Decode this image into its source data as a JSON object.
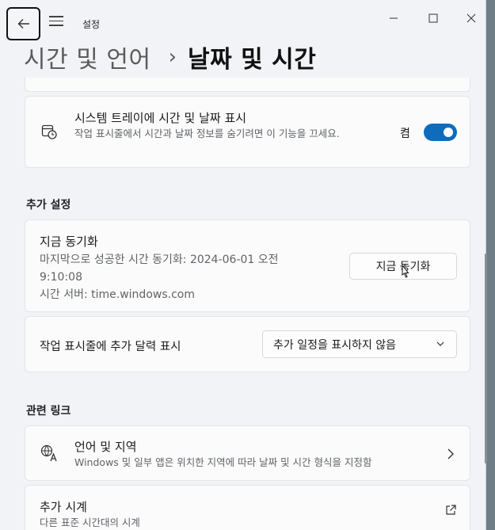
{
  "app": {
    "title": "설정"
  },
  "header": {
    "parent": "시간 및 언어",
    "separator": "›",
    "current": "날짜 및 시간"
  },
  "tray_card": {
    "title": "시스템 트레이에 시간 및 날짜 표시",
    "description": "작업 표시줄에서 시간과 날짜 정보를 숨기려면 이 기능을 끄세요.",
    "toggle_label": "켬",
    "toggle_on": true
  },
  "additional_settings": {
    "heading": "추가 설정",
    "sync": {
      "title": "지금 동기화",
      "last_sync_line1": "마지막으로 성공한 시간 동기화: 2024-06-01 오전",
      "last_sync_line2": "9:10:08",
      "server": "시간 서버: time.windows.com",
      "button_label": "지금 동기화"
    },
    "calendar": {
      "label": "작업 표시줄에 추가 달력 표시",
      "selected": "추가 일정을 표시하지 않음"
    }
  },
  "related_links": {
    "heading": "관련 링크",
    "language_region": {
      "title": "언어 및 지역",
      "description": "Windows 및 일부 앱은 위치한 지역에 따라 날짜 및 시간 형식을 지정함"
    },
    "additional_clocks": {
      "title": "추가 시계",
      "description": "다른 표준 시간대의 시계"
    }
  },
  "colors": {
    "accent": "#0f6cbd",
    "background": "#f1f3f6",
    "card": "#fbfbfc"
  },
  "icons": [
    "back-arrow-icon",
    "hamburger-icon",
    "minimize-icon",
    "maximize-icon",
    "close-icon",
    "calendar-clock-icon",
    "language-icon",
    "chevron-right-icon",
    "external-link-icon",
    "chevron-down-icon"
  ]
}
